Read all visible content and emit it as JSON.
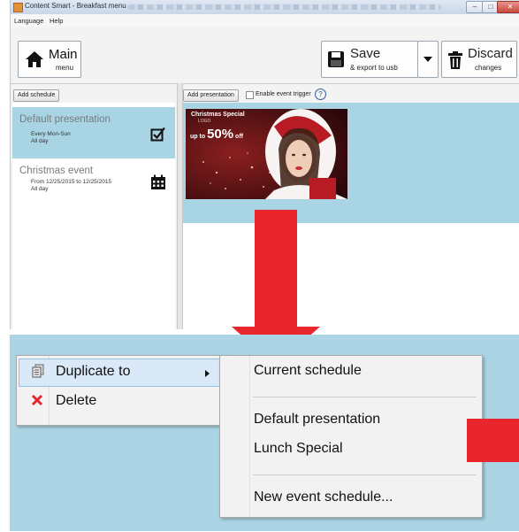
{
  "window": {
    "title": "Content Smart - Breakfast menu",
    "menu": [
      "Language",
      "Help"
    ]
  },
  "toolbar": {
    "main": {
      "label": "Main",
      "sub": "menu"
    },
    "save": {
      "label": "Save",
      "sub": "& export to usb"
    },
    "discard": {
      "label": "Discard",
      "sub": "changes"
    }
  },
  "schedules": {
    "add_button": "Add schedule",
    "items": [
      {
        "name": "Default presentation",
        "line1": "Every Mon-Sun",
        "line2": "All day",
        "icon": "checkbox-icon",
        "selected": true
      },
      {
        "name": "Christmas event",
        "line1": "From 12/25/2015 to 12/25/2015",
        "line2": "All day",
        "icon": "calendar-icon",
        "selected": false
      }
    ]
  },
  "presentations": {
    "add_button": "Add presentation",
    "event_trigger_label": "Enable event trigger",
    "help_icon": "?",
    "thumbnail": {
      "title": "Christmas Special",
      "logo": "LOGO",
      "offer_pre": "up to",
      "offer_big": "50%",
      "offer_post": "off"
    }
  },
  "context_menu": {
    "items": [
      {
        "label": "Duplicate to",
        "icon": "duplicate-icon"
      },
      {
        "label": "Delete",
        "icon": "delete-x-icon"
      }
    ]
  },
  "submenu": {
    "current": "Current schedule",
    "existing": [
      "Default presentation",
      "Lunch Special"
    ],
    "new": "New event schedule..."
  },
  "colors": {
    "accent_red": "#e8262c",
    "selection_blue": "#a9d4e3"
  }
}
